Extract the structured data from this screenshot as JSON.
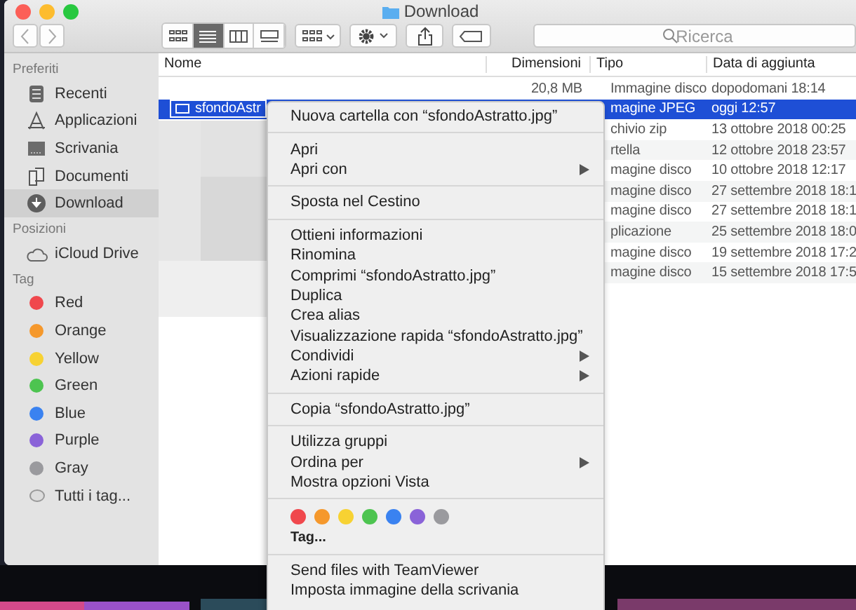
{
  "window": {
    "title": "Download"
  },
  "toolbar": {
    "view_modes": [
      {
        "selected": false
      },
      {
        "selected": true
      },
      {
        "selected": false
      },
      {
        "selected": false
      }
    ],
    "search": {
      "placeholder": "Ricerca"
    }
  },
  "sidebar": [
    {
      "heading": "Preferiti",
      "items": [
        {
          "label": "Recenti",
          "kind": "recents",
          "selected": false
        },
        {
          "label": "Applicazioni",
          "kind": "apps",
          "selected": false
        },
        {
          "label": "Scrivania",
          "kind": "desktop",
          "selected": false
        },
        {
          "label": "Documenti",
          "kind": "documents",
          "selected": false
        },
        {
          "label": "Download",
          "kind": "download",
          "selected": true
        }
      ]
    },
    {
      "heading": "Posizioni",
      "items": [
        {
          "label": "iCloud Drive",
          "kind": "cloud",
          "selected": false
        }
      ]
    },
    {
      "heading": "Tag",
      "items": [
        {
          "label": "Red",
          "kind": "tag",
          "color": "#f0484d",
          "selected": false
        },
        {
          "label": "Orange",
          "kind": "tag",
          "color": "#f5982c",
          "selected": false
        },
        {
          "label": "Yellow",
          "kind": "tag",
          "color": "#f7d233",
          "selected": false
        },
        {
          "label": "Green",
          "kind": "tag",
          "color": "#4dc450",
          "selected": false
        },
        {
          "label": "Blue",
          "kind": "tag",
          "color": "#3a82f0",
          "selected": false
        },
        {
          "label": "Purple",
          "kind": "tag",
          "color": "#8a63d8",
          "selected": false
        },
        {
          "label": "Gray",
          "kind": "tag",
          "color": "#9a9a9e",
          "selected": false
        },
        {
          "label": "Tutti i tag...",
          "kind": "alltags",
          "selected": false
        }
      ]
    }
  ],
  "table": {
    "columns": [
      "Nome",
      "Dimensioni",
      "Tipo",
      "Data di aggiunta"
    ],
    "rows": [
      {
        "size": "20,8 MB",
        "type": "Immagine disco",
        "date": "dopodomani 18:14",
        "selected": false
      },
      {
        "name": "sfondoAstr",
        "type": "magine JPEG",
        "date": "oggi 12:57",
        "selected": true
      },
      {
        "type": "chivio zip",
        "date": "13 ottobre 2018 00:25",
        "selected": false
      },
      {
        "type": "rtella",
        "date": "12 ottobre 2018 23:57",
        "selected": false
      },
      {
        "type": "magine disco",
        "date": "10 ottobre 2018 12:17",
        "selected": false
      },
      {
        "type": "magine disco",
        "date": "27 settembre 2018 18:1",
        "selected": false
      },
      {
        "type": "magine disco",
        "date": "27 settembre 2018 18:1",
        "selected": false
      },
      {
        "type": "plicazione",
        "date": "25 settembre 2018 18:0",
        "selected": false
      },
      {
        "type": "magine disco",
        "date": "19 settembre 2018 17:2",
        "selected": false
      },
      {
        "type": "magine disco",
        "date": "15 settembre 2018 17:5",
        "selected": false
      }
    ]
  },
  "context_menu": {
    "groups": [
      [
        {
          "label": "Nuova cartella con “sfondoAstratto.jpg”",
          "submenu": false
        }
      ],
      [
        {
          "label": "Apri",
          "submenu": false
        },
        {
          "label": "Apri con",
          "submenu": true
        }
      ],
      [
        {
          "label": "Sposta nel Cestino",
          "submenu": false
        }
      ],
      [
        {
          "label": "Ottieni informazioni",
          "submenu": false
        },
        {
          "label": "Rinomina",
          "submenu": false
        },
        {
          "label": "Comprimi “sfondoAstratto.jpg”",
          "submenu": false
        },
        {
          "label": "Duplica",
          "submenu": false
        },
        {
          "label": "Crea alias",
          "submenu": false
        },
        {
          "label": "Visualizzazione rapida “sfondoAstratto.jpg”",
          "submenu": false
        },
        {
          "label": "Condividi",
          "submenu": true
        },
        {
          "label": "Azioni rapide",
          "submenu": true
        }
      ],
      [
        {
          "label": "Copia “sfondoAstratto.jpg”",
          "submenu": false
        }
      ],
      [
        {
          "label": "Utilizza gruppi",
          "submenu": false
        },
        {
          "label": "Ordina per",
          "submenu": true
        },
        {
          "label": "Mostra opzioni Vista",
          "submenu": false
        }
      ]
    ],
    "tag_colors": [
      {
        "color": "#f0484d"
      },
      {
        "color": "#f5982c"
      },
      {
        "color": "#f7d233"
      },
      {
        "color": "#4dc450"
      },
      {
        "color": "#3a82f0"
      },
      {
        "color": "#8a63d8"
      },
      {
        "color": "#9a9a9e"
      }
    ],
    "tags_label": "Tag...",
    "extra_items": [
      {
        "label": "Send files with TeamViewer",
        "submenu": false
      },
      {
        "label": "Imposta immagine della scrivania",
        "submenu": false
      }
    ]
  }
}
